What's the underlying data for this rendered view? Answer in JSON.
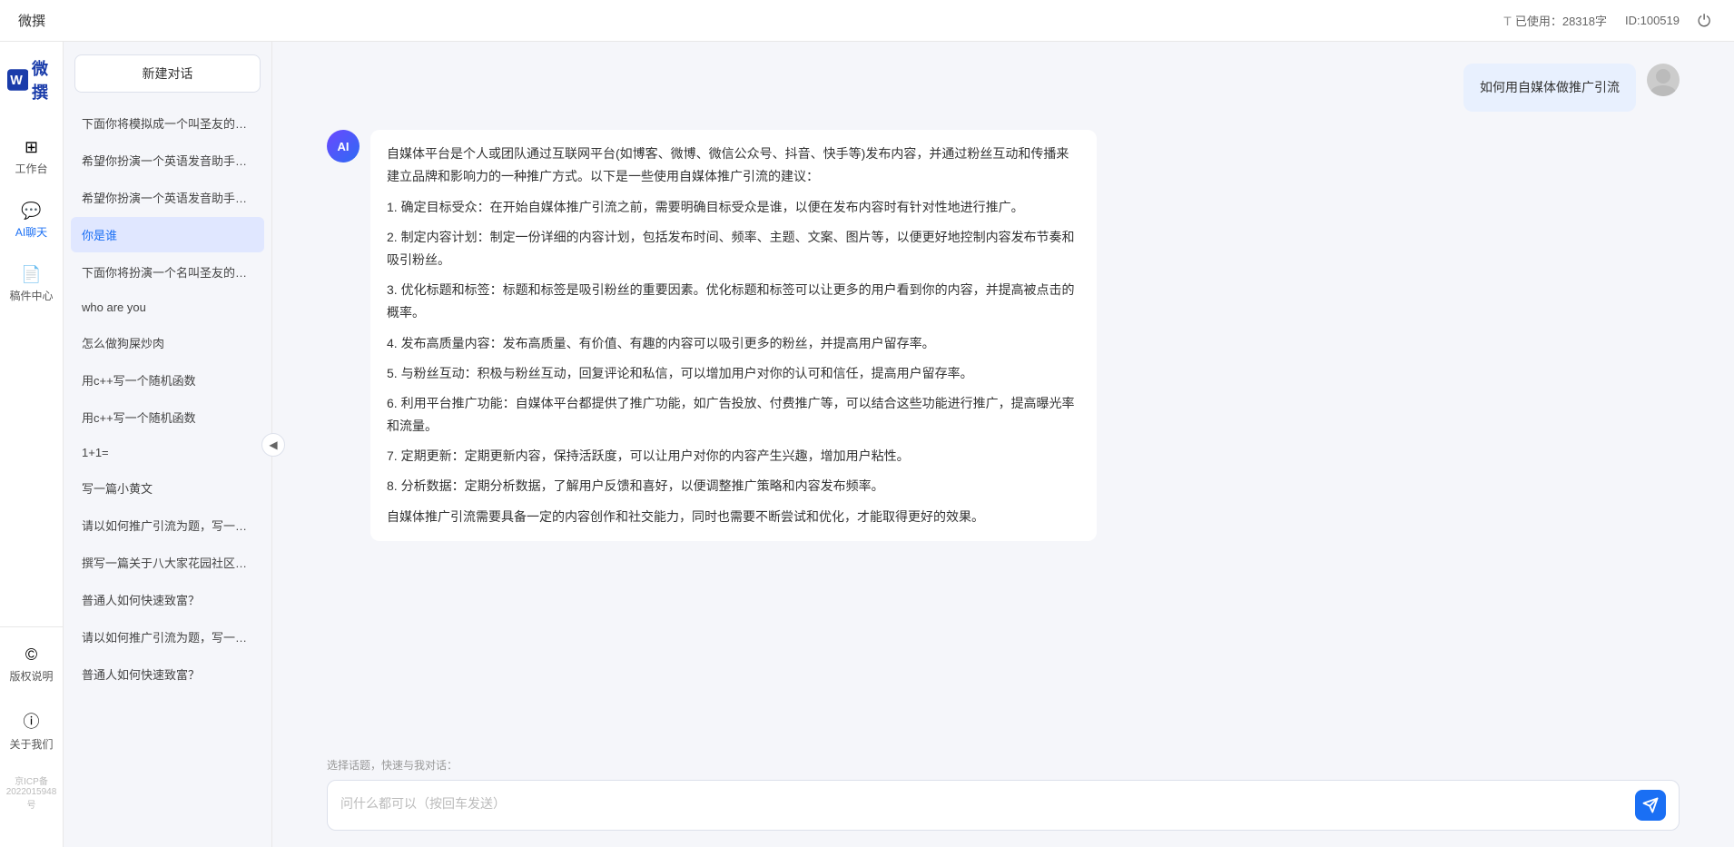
{
  "topbar": {
    "title": "微撰",
    "word_count_icon": "T",
    "word_count_label": "已使用：28318字",
    "id_label": "ID:100519",
    "power_button_label": "退出"
  },
  "logo": {
    "text": "微撰"
  },
  "nav": {
    "items": [
      {
        "id": "workbench",
        "label": "工作台",
        "icon": "⊞"
      },
      {
        "id": "ai-chat",
        "label": "AI聊天",
        "icon": "💬"
      },
      {
        "id": "draft",
        "label": "稿件中心",
        "icon": "📄"
      }
    ],
    "bottom_items": [
      {
        "id": "copyright",
        "label": "版权说明",
        "icon": "©"
      },
      {
        "id": "about",
        "label": "关于我们",
        "icon": "ⓘ"
      }
    ],
    "beian": "京ICP备2022015948号"
  },
  "conv_panel": {
    "new_chat_label": "新建对话",
    "conversations": [
      {
        "id": 1,
        "text": "下面你将模拟成一个叫圣友的程序员，我说..."
      },
      {
        "id": 2,
        "text": "希望你扮演一个英语发音助手，我提供给你..."
      },
      {
        "id": 3,
        "text": "希望你扮演一个英语发音助手，我提供给你..."
      },
      {
        "id": 4,
        "text": "你是谁",
        "active": true
      },
      {
        "id": 5,
        "text": "下面你将扮演一个名叫圣友的医生"
      },
      {
        "id": 6,
        "text": "who are you"
      },
      {
        "id": 7,
        "text": "怎么做狗屎炒肉"
      },
      {
        "id": 8,
        "text": "用c++写一个随机函数"
      },
      {
        "id": 9,
        "text": "用c++写一个随机函数"
      },
      {
        "id": 10,
        "text": "1+1="
      },
      {
        "id": 11,
        "text": "写一篇小黄文"
      },
      {
        "id": 12,
        "text": "请以如何推广引流为题，写一篇大纲"
      },
      {
        "id": 13,
        "text": "撰写一篇关于八大家花园社区一刻钟便民生..."
      },
      {
        "id": 14,
        "text": "普通人如何快速致富？"
      },
      {
        "id": 15,
        "text": "请以如何推广引流为题，写一篇大纲"
      },
      {
        "id": 16,
        "text": "普通人如何快速致富？"
      }
    ]
  },
  "chat": {
    "user_message": "如何用自媒体做推广引流",
    "ai_response": {
      "paragraphs": [
        "自媒体平台是个人或团队通过互联网平台(如博客、微博、微信公众号、抖音、快手等)发布内容，并通过粉丝互动和传播来建立品牌和影响力的一种推广方式。以下是一些使用自媒体推广引流的建议：",
        "1. 确定目标受众：在开始自媒体推广引流之前，需要明确目标受众是谁，以便在发布内容时有针对性地进行推广。",
        "2. 制定内容计划：制定一份详细的内容计划，包括发布时间、频率、主题、文案、图片等，以便更好地控制内容发布节奏和吸引粉丝。",
        "3. 优化标题和标签：标题和标签是吸引粉丝的重要因素。优化标题和标签可以让更多的用户看到你的内容，并提高被点击的概率。",
        "4. 发布高质量内容：发布高质量、有价值、有趣的内容可以吸引更多的粉丝，并提高用户留存率。",
        "5. 与粉丝互动：积极与粉丝互动，回复评论和私信，可以增加用户对你的认可和信任，提高用户留存率。",
        "6. 利用平台推广功能：自媒体平台都提供了推广功能，如广告投放、付费推广等，可以结合这些功能进行推广，提高曝光率和流量。",
        "7. 定期更新：定期更新内容，保持活跃度，可以让用户对你的内容产生兴趣，增加用户粘性。",
        "8. 分析数据：定期分析数据，了解用户反馈和喜好，以便调整推广策略和内容发布频率。",
        "自媒体推广引流需要具备一定的内容创作和社交能力，同时也需要不断尝试和优化，才能取得更好的效果。"
      ]
    },
    "quick_topics_label": "选择话题，快速与我对话：",
    "input_placeholder": "问什么都可以（按回车发送）"
  }
}
